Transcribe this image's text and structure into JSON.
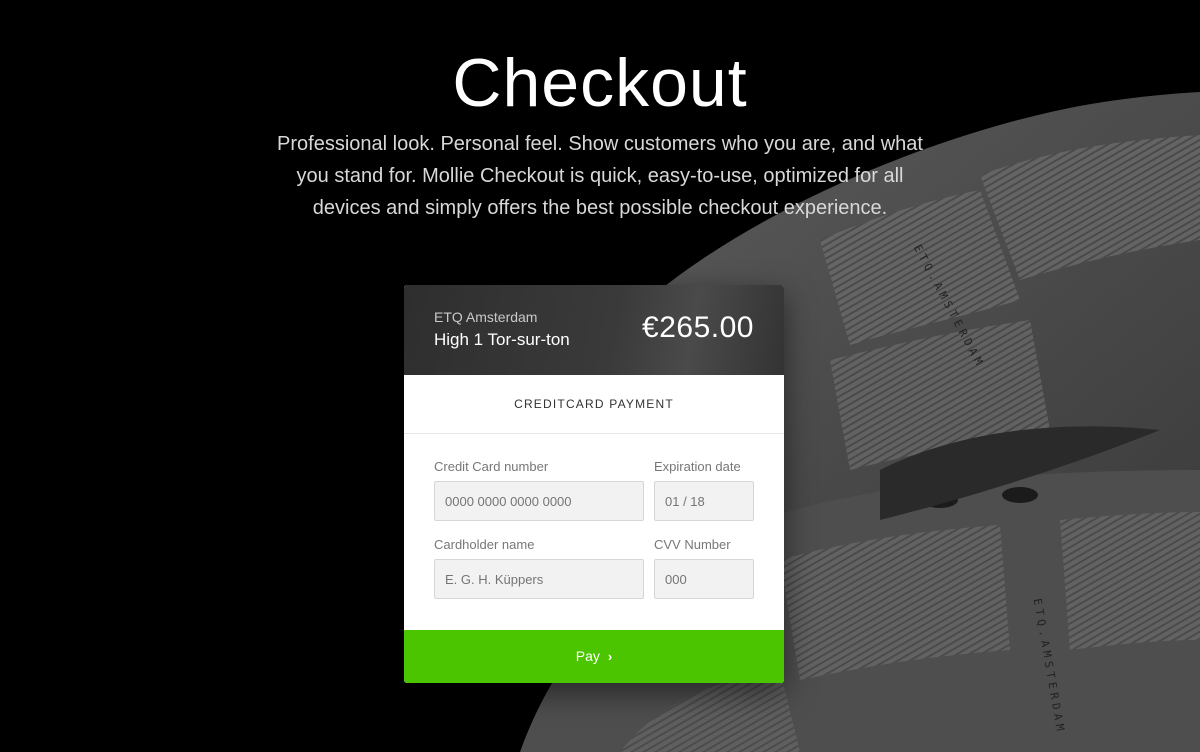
{
  "hero": {
    "title": "Checkout",
    "description": "Professional look. Personal feel. Show customers who you are, and what you stand for. Mollie Checkout is quick, easy-to-use, optimized for all devices and simply offers the best possible checkout experience."
  },
  "card": {
    "merchant": "ETQ Amsterdam",
    "product": "High 1 Tor-sur-ton",
    "amount": "€265.00",
    "method_title": "CREDITCARD PAYMENT",
    "fields": {
      "card_number": {
        "label": "Credit Card number",
        "placeholder": "0000 0000 0000 0000"
      },
      "expiration": {
        "label": "Expiration date",
        "placeholder": "01 / 18"
      },
      "cardholder": {
        "label": "Cardholder name",
        "placeholder": "E. G. H. Küppers"
      },
      "cvv": {
        "label": "CVV Number",
        "placeholder": "000"
      }
    },
    "pay_label": "Pay",
    "pay_icon": "chevron-right-icon",
    "accent_color": "#4bc500"
  },
  "background": {
    "brand_text": "ETQ.AMSTERDAM"
  }
}
